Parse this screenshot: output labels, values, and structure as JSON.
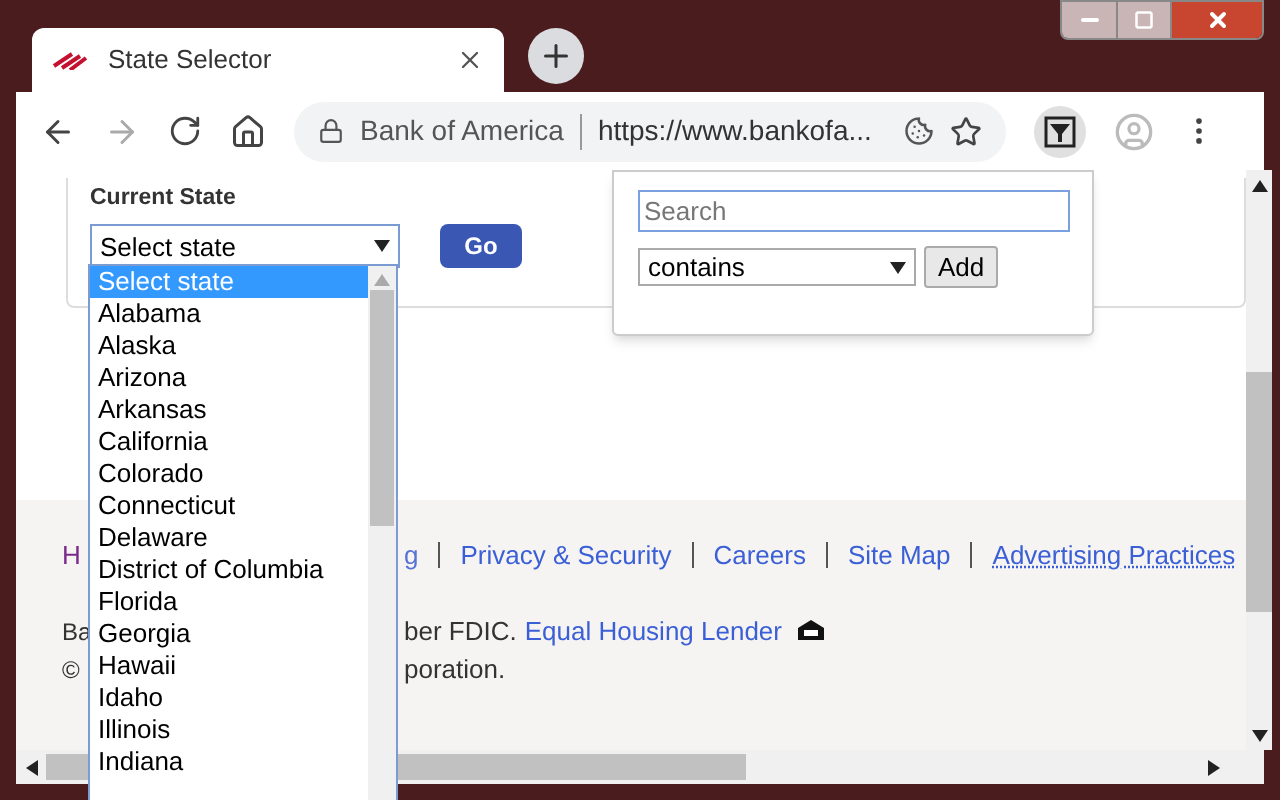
{
  "tab": {
    "title": "State Selector"
  },
  "address": {
    "site": "Bank of America",
    "url": "https://www.bankofa..."
  },
  "form": {
    "label": "Current State",
    "select": {
      "value": "Select state",
      "expanded": true
    },
    "go": "Go"
  },
  "options": [
    {
      "label": "Select state",
      "selected": true
    },
    {
      "label": "Alabama",
      "selected": false
    },
    {
      "label": "Alaska",
      "selected": false
    },
    {
      "label": "Arizona",
      "selected": false
    },
    {
      "label": "Arkansas",
      "selected": false
    },
    {
      "label": "California",
      "selected": false
    },
    {
      "label": "Colorado",
      "selected": false
    },
    {
      "label": "Connecticut",
      "selected": false
    },
    {
      "label": "Delaware",
      "selected": false
    },
    {
      "label": "District of Columbia",
      "selected": false
    },
    {
      "label": "Florida",
      "selected": false
    },
    {
      "label": "Georgia",
      "selected": false
    },
    {
      "label": "Hawaii",
      "selected": false
    },
    {
      "label": "Idaho",
      "selected": false
    },
    {
      "label": "Illinois",
      "selected": false
    },
    {
      "label": "Indiana",
      "selected": false
    }
  ],
  "popup": {
    "search_placeholder": "Search",
    "match": "contains",
    "add": "Add"
  },
  "footer": {
    "fragment_left": "H",
    "fragment_link": "g",
    "links": [
      {
        "text": "Privacy & Security",
        "underlined": false
      },
      {
        "text": "Careers",
        "underlined": false
      },
      {
        "text": "Site Map",
        "underlined": false
      },
      {
        "text": "Advertising Practices",
        "underlined": true
      }
    ],
    "line1_start": "Ba",
    "line1_rest": "ber FDIC.",
    "line1_link": "Equal Housing Lender",
    "line2_start": "©",
    "line2_rest": "poration."
  }
}
